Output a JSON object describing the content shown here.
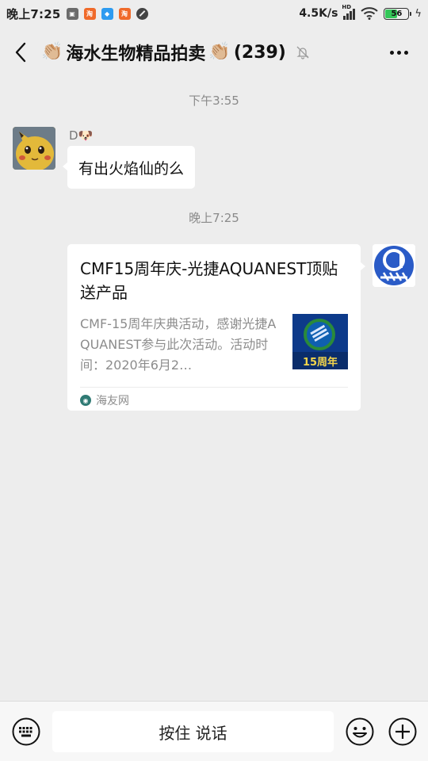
{
  "status_bar": {
    "time": "晚上7:25",
    "notification_icons": [
      "gallery-icon",
      "taobao-icon",
      "app-icon",
      "taobao-icon",
      "no-disturb-icon"
    ],
    "network_speed": "4.5K/s",
    "hd_label": "HD",
    "battery_level": "56",
    "battery_fraction": 0.56
  },
  "header": {
    "back_icon": "chevron-left-icon",
    "clap_left": "👏🏼",
    "group_name": "海水生物精品拍卖",
    "clap_right": "👏🏼",
    "member_count": "(239)",
    "mute_icon": "bell-off-icon",
    "more_icon": "more-icon"
  },
  "messages": {
    "timestamp_1": "下午3:55",
    "incoming": {
      "sender_name": "D🐶",
      "text": "有出火焰仙的么"
    },
    "timestamp_2": "晚上7:25",
    "outgoing_link": {
      "title": "CMF15周年庆-光捷AQUANEST顶贴送产品",
      "description": "CMF-15周年庆典活动，感谢光捷AQUANEST参与此次活动。活动时间：2020年6月2…",
      "thumb_text": "15周年",
      "source": "海友网"
    }
  },
  "input_bar": {
    "hold_to_talk": "按住 说话",
    "keyboard_icon": "keyboard-icon",
    "emoji_icon": "emoji-icon",
    "plus_icon": "plus-icon"
  },
  "colors": {
    "background": "#ededed",
    "bubble": "#ffffff",
    "battery_green": "#34c759"
  }
}
